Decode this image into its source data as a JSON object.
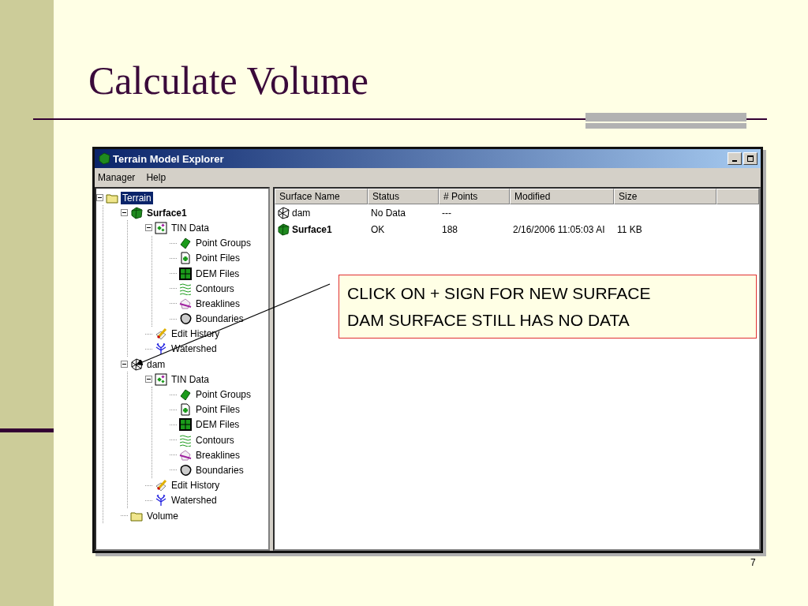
{
  "slide": {
    "title": "Calculate Volume",
    "page_number": "7"
  },
  "window": {
    "title": "Terrain Model Explorer"
  },
  "menu": [
    "Manager",
    "Help"
  ],
  "tree": [
    {
      "label": "Terrain",
      "kind": "folder",
      "selected": true,
      "current": false,
      "expanded": true,
      "children": [
        {
          "label": "Surface1",
          "kind": "surface",
          "selected": false,
          "current": true,
          "expanded": true,
          "children": [
            {
              "label": "TIN Data",
              "kind": "tin",
              "selected": false,
              "current": false,
              "expanded": true,
              "children": [
                {
                  "label": "Point Groups",
                  "kind": "point-groups",
                  "selected": false,
                  "current": false
                },
                {
                  "label": "Point Files",
                  "kind": "point-file",
                  "selected": false,
                  "current": false
                },
                {
                  "label": "DEM Files",
                  "kind": "dem",
                  "selected": false,
                  "current": false
                },
                {
                  "label": "Contours",
                  "kind": "contours",
                  "selected": false,
                  "current": false
                },
                {
                  "label": "Breaklines",
                  "kind": "breaklines",
                  "selected": false,
                  "current": false
                },
                {
                  "label": "Boundaries",
                  "kind": "boundaries",
                  "selected": false,
                  "current": false
                }
              ]
            },
            {
              "label": "Edit History",
              "kind": "edit-history",
              "selected": false,
              "current": false
            },
            {
              "label": "Watershed",
              "kind": "watershed",
              "selected": false,
              "current": false
            }
          ]
        },
        {
          "label": "dam",
          "kind": "wireframe",
          "selected": false,
          "current": false,
          "expanded": true,
          "children": [
            {
              "label": "TIN Data",
              "kind": "tin",
              "selected": false,
              "current": false,
              "expanded": true,
              "children": [
                {
                  "label": "Point Groups",
                  "kind": "point-groups",
                  "selected": false,
                  "current": false
                },
                {
                  "label": "Point Files",
                  "kind": "point-file",
                  "selected": false,
                  "current": false
                },
                {
                  "label": "DEM Files",
                  "kind": "dem",
                  "selected": false,
                  "current": false
                },
                {
                  "label": "Contours",
                  "kind": "contours",
                  "selected": false,
                  "current": false
                },
                {
                  "label": "Breaklines",
                  "kind": "breaklines",
                  "selected": false,
                  "current": false
                },
                {
                  "label": "Boundaries",
                  "kind": "boundaries",
                  "selected": false,
                  "current": false
                }
              ]
            },
            {
              "label": "Edit History",
              "kind": "edit-history",
              "selected": false,
              "current": false
            },
            {
              "label": "Watershed",
              "kind": "watershed",
              "selected": false,
              "current": false
            }
          ]
        },
        {
          "label": "Volume",
          "kind": "folder",
          "selected": false,
          "current": false
        }
      ]
    }
  ],
  "table": {
    "columns": [
      "Surface Name",
      "Status",
      "# Points",
      "Modified",
      "Size"
    ],
    "rows": [
      {
        "kind": "wireframe",
        "current": false,
        "cells": [
          "dam",
          "No Data",
          "---",
          "",
          ""
        ]
      },
      {
        "kind": "surface",
        "current": true,
        "cells": [
          "Surface1",
          "OK",
          "188",
          "2/16/2006 11:05:03 AI",
          "11 KB"
        ]
      }
    ]
  },
  "callout": {
    "lines": [
      "CLICK ON + SIGN FOR NEW SURFACE",
      "DAM SURFACE STILL HAS NO DATA"
    ]
  }
}
